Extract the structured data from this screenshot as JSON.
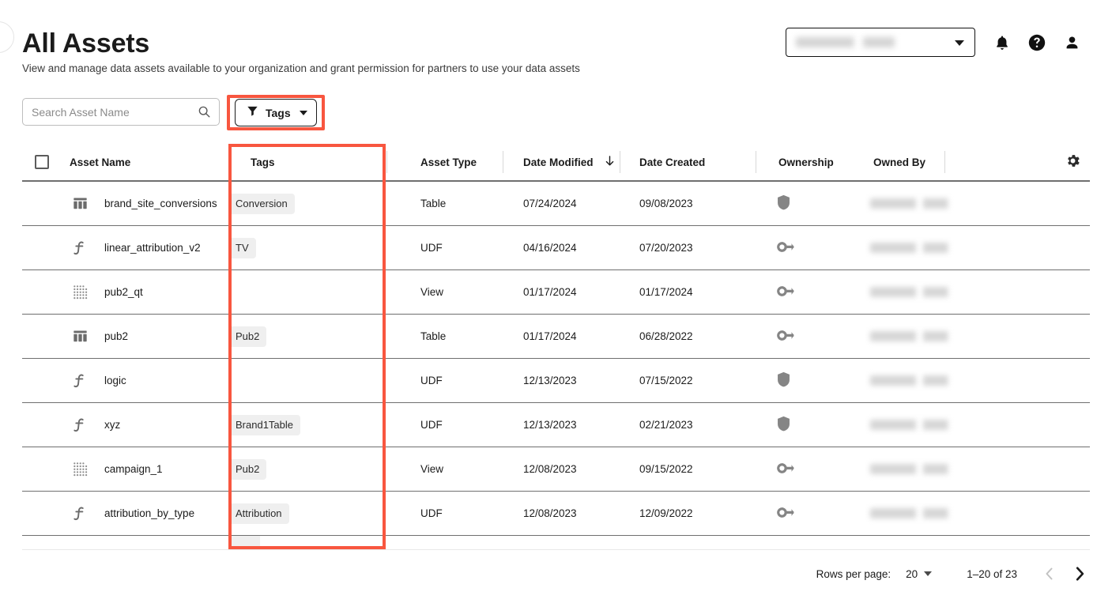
{
  "header": {
    "title": "All Assets",
    "subtitle": "View and manage data assets available to your organization and grant permission for partners to use your data assets",
    "org_selector": {
      "value": "",
      "icon": "chevron-down-icon"
    },
    "icons": [
      {
        "name": "bell-icon",
        "label": "Notifications"
      },
      {
        "name": "help-circle-icon",
        "label": "Help"
      },
      {
        "name": "account-person-icon",
        "label": "Account"
      }
    ]
  },
  "toolbar": {
    "search": {
      "placeholder": "Search Asset Name",
      "value": "",
      "icon": "search-icon"
    },
    "tags_filter": {
      "label": "Tags",
      "icon": "filter-funnel-icon",
      "caret": "caret-down-icon",
      "highlighted": true
    }
  },
  "highlight_color": "#f8563f",
  "table": {
    "columns": [
      {
        "key": "select",
        "label": ""
      },
      {
        "key": "asset_name",
        "label": "Asset Name"
      },
      {
        "key": "tags",
        "label": "Tags"
      },
      {
        "key": "asset_type",
        "label": "Asset Type"
      },
      {
        "key": "date_modified",
        "label": "Date Modified",
        "sort": "descending",
        "sort_icon": "arrow-down-icon"
      },
      {
        "key": "date_created",
        "label": "Date Created"
      },
      {
        "key": "ownership",
        "label": "Ownership"
      },
      {
        "key": "owned_by",
        "label": "Owned By"
      },
      {
        "key": "settings",
        "label": "",
        "icon": "gear-icon"
      }
    ],
    "rows": [
      {
        "name": "brand_site_conversions",
        "name_icon": "table-icon",
        "tag": "Conversion",
        "type": "Table",
        "date_modified": "07/24/2024",
        "date_created": "09/08/2023",
        "ownership_icon": "shield-icon",
        "owned_by": ""
      },
      {
        "name": "linear_attribution_v2",
        "name_icon": "function-icon",
        "tag": "TV",
        "type": "UDF",
        "date_modified": "04/16/2024",
        "date_created": "07/20/2023",
        "ownership_icon": "key-icon",
        "owned_by": ""
      },
      {
        "name": "pub2_qt",
        "name_icon": "view-grid-icon",
        "tag": "",
        "type": "View",
        "date_modified": "01/17/2024",
        "date_created": "01/17/2024",
        "ownership_icon": "key-icon",
        "owned_by": ""
      },
      {
        "name": "pub2",
        "name_icon": "table-icon",
        "tag": "Pub2",
        "type": "Table",
        "date_modified": "01/17/2024",
        "date_created": "06/28/2022",
        "ownership_icon": "key-icon",
        "owned_by": ""
      },
      {
        "name": "logic",
        "name_icon": "function-icon",
        "tag": "",
        "type": "UDF",
        "date_modified": "12/13/2023",
        "date_created": "07/15/2022",
        "ownership_icon": "shield-icon",
        "owned_by": ""
      },
      {
        "name": "xyz",
        "name_icon": "function-icon",
        "tag": "Brand1Table",
        "type": "UDF",
        "date_modified": "12/13/2023",
        "date_created": "02/21/2023",
        "ownership_icon": "shield-icon",
        "owned_by": ""
      },
      {
        "name": "campaign_1",
        "name_icon": "view-grid-icon",
        "tag": "Pub2",
        "type": "View",
        "date_modified": "12/08/2023",
        "date_created": "09/15/2022",
        "ownership_icon": "key-icon",
        "owned_by": ""
      },
      {
        "name": "attribution_by_type",
        "name_icon": "function-icon",
        "tag": "Attribution",
        "type": "UDF",
        "date_modified": "12/08/2023",
        "date_created": "12/09/2022",
        "ownership_icon": "key-icon",
        "owned_by": ""
      }
    ]
  },
  "footer": {
    "rows_per_page_label": "Rows per page:",
    "rows_per_page_value": "20",
    "range_label": "1–20 of 23",
    "prev_icon": "chevron-left-icon",
    "next_icon": "chevron-right-icon",
    "prev_enabled": false,
    "next_enabled": true
  }
}
